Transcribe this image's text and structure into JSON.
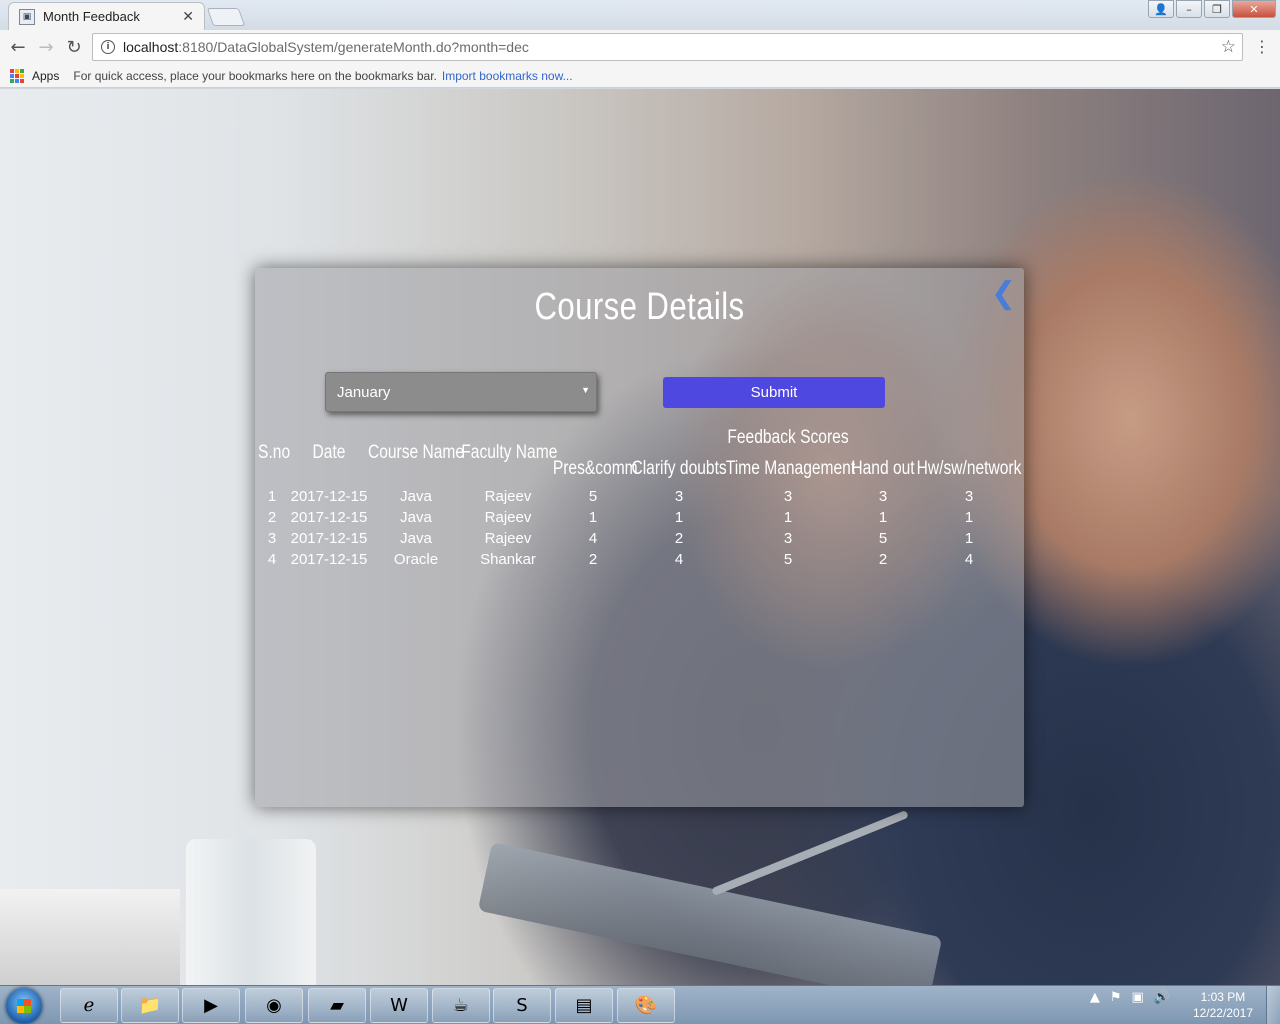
{
  "browser": {
    "tab_title": "Month Feedback",
    "tab_close": "✕",
    "url_host": "localhost",
    "url_rest": ":8180/DataGlobalSystem/generateMonth.do?month=dec",
    "bookmarks": {
      "apps_label": "Apps",
      "hint": "For quick access, place your bookmarks here on the bookmarks bar.",
      "import_link": "Import bookmarks now..."
    }
  },
  "card": {
    "title": "Course Details",
    "month_select": {
      "value": "January"
    },
    "submit_label": "Submit",
    "table": {
      "group_header": "Feedback Scores",
      "headers": {
        "sno": "S.no",
        "date": "Date",
        "course": "Course Name",
        "faculty": "Faculty Name",
        "pres": "Pres&comm",
        "clarify": "Clarify doubts",
        "time": "Time Management",
        "handout": "Hand out",
        "hw": "Hw/sw/network"
      },
      "rows": [
        [
          "1",
          "2017-12-15",
          "Java",
          "Rajeev",
          "5",
          "3",
          "3",
          "3",
          "3"
        ],
        [
          "2",
          "2017-12-15",
          "Java",
          "Rajeev",
          "1",
          "1",
          "1",
          "1",
          "1"
        ],
        [
          "3",
          "2017-12-15",
          "Java",
          "Rajeev",
          "4",
          "2",
          "3",
          "5",
          "1"
        ],
        [
          "4",
          "2017-12-15",
          "Oracle",
          "Shankar",
          "2",
          "4",
          "5",
          "2",
          "4"
        ]
      ]
    }
  },
  "taskbar": {
    "clock_time": "1:03 PM",
    "clock_date": "12/22/2017",
    "apps": [
      "internet-explorer",
      "file-explorer",
      "media-player",
      "chrome",
      "sticky-notes",
      "word",
      "java-ee-ide",
      "skype",
      "sql-plus",
      "paint"
    ]
  },
  "colors": {
    "submit": "#4e47e0",
    "back_arrow": "#4a7dd8",
    "link": "#3366cc"
  }
}
